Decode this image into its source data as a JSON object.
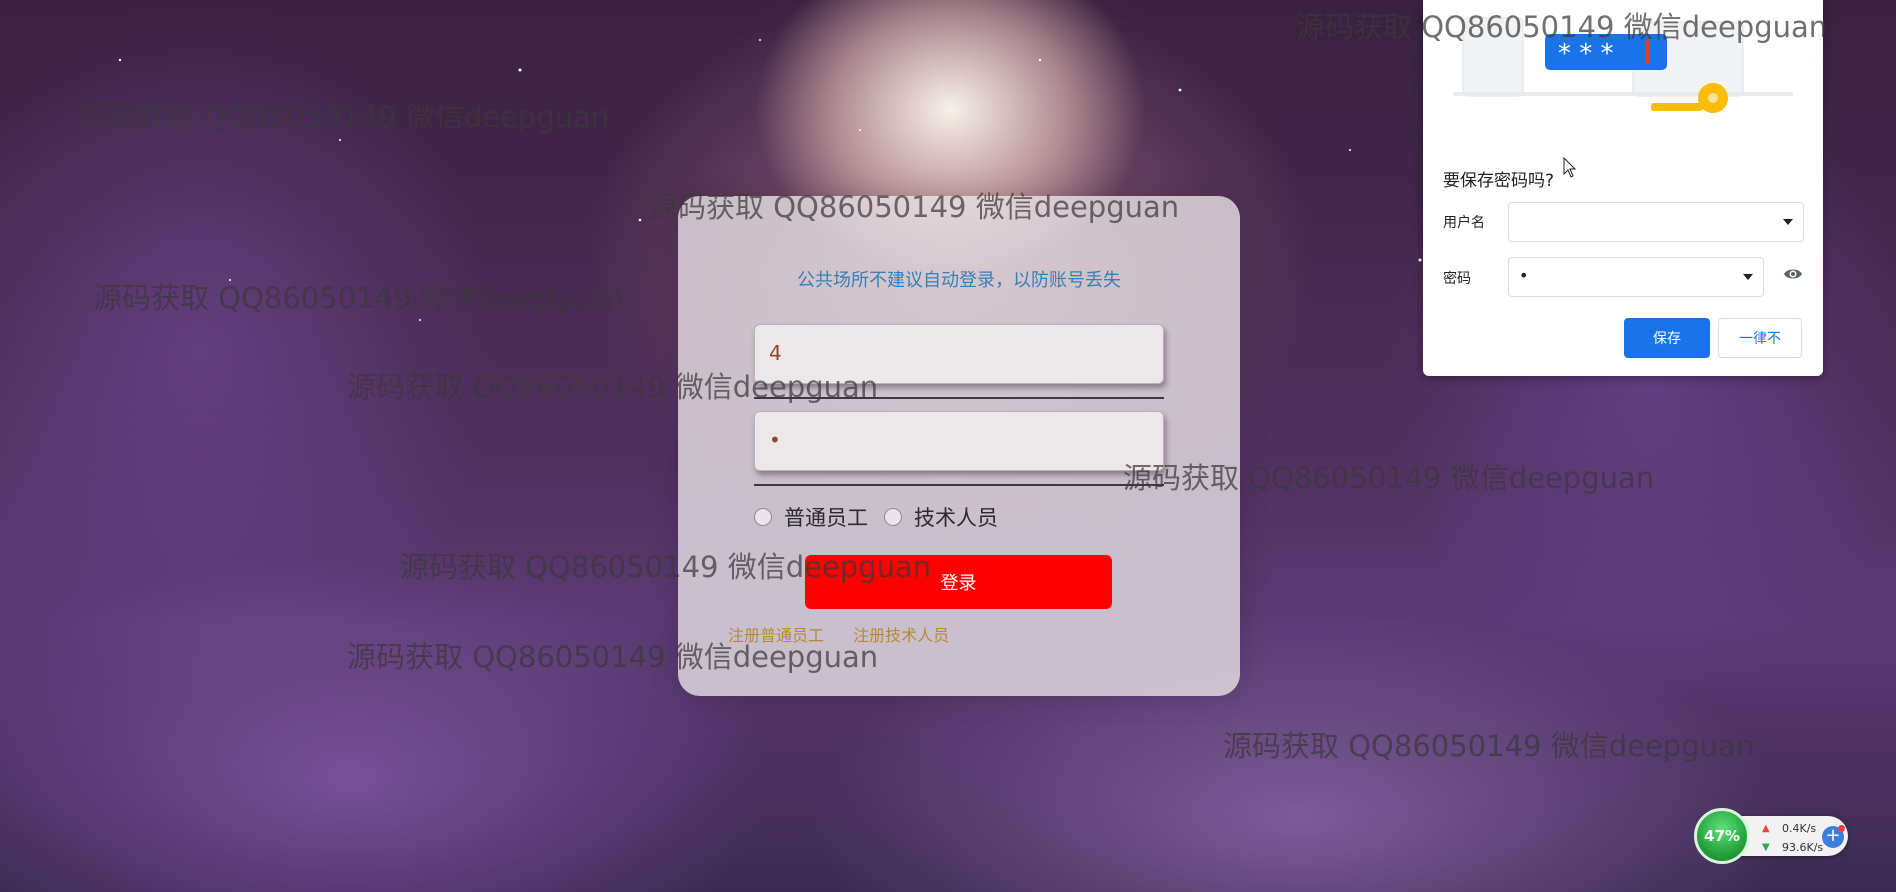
{
  "watermark_text": "源码获取 QQ86050149 微信deepguan",
  "login": {
    "notice": "公共场所不建议自动登录，以防账号丢失",
    "username_value": "4",
    "password_value": "•",
    "roles": [
      "普通员工",
      "技术人员"
    ],
    "login_label": "登录",
    "register_employee": "注册普通员工",
    "register_technician": "注册技术人员"
  },
  "save_password_popup": {
    "title": "要保存密码吗?",
    "username_label": "用户名",
    "username_value": "",
    "password_label": "密码",
    "password_value": "•",
    "save_label": "保存",
    "never_label": "一律不",
    "stars": "* * *"
  },
  "network_widget": {
    "percent": "47%",
    "upload": "0.4K/s",
    "download": "93.6K/s",
    "plus": "+"
  },
  "colors": {
    "login_button": "#ff0000",
    "notice_text": "#3a7eb5",
    "register_links": "#b58a37",
    "save_button": "#1a73e8"
  }
}
